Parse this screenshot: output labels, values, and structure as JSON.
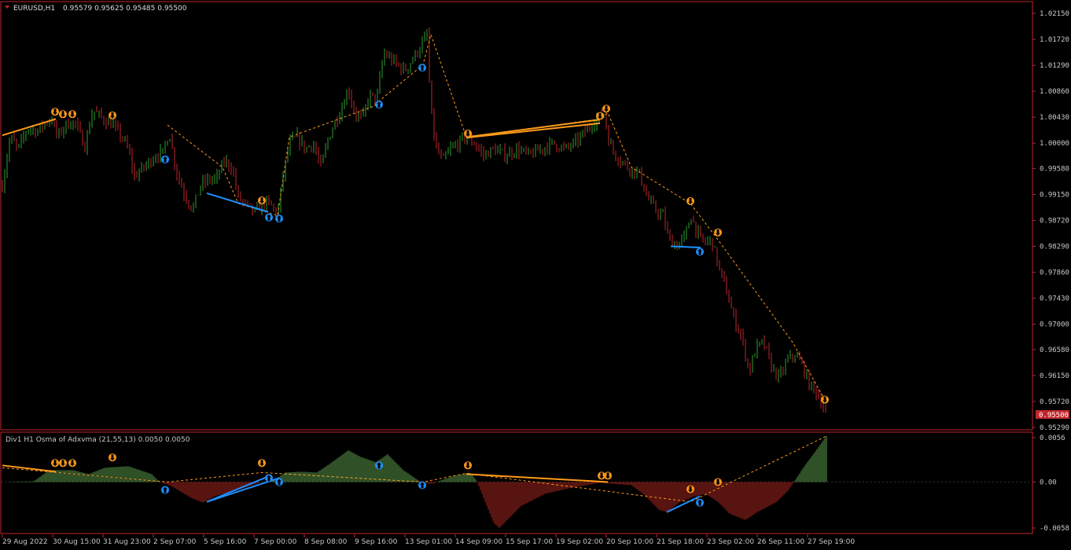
{
  "main_header": {
    "symbol": "EURUSD,H1",
    "ohlc": "0.95579 0.95625 0.95485 0.95500"
  },
  "indicator_header": {
    "label": "Div1 H1 Osma of Adxvma (21,55,13) 0.0050 0.0050"
  },
  "current_price": "0.95500",
  "colors": {
    "background": "#000000",
    "frame": "#c0262c",
    "bull": "#2f9e2f",
    "bear": "#c0262c",
    "hist_pos": "#5f9f4f",
    "hist_neg": "#b0271f",
    "bear_div": "#ff9a1a",
    "bull_div": "#1e90ff",
    "axis_text": "#c8c8c8",
    "header_text": "#dcdcdc"
  },
  "chart_data": [
    {
      "type": "candlestick",
      "title": "EURUSD,H1",
      "ylim": [
        0.9518,
        1.0228
      ],
      "y_ticks": [
        "1.02150",
        "1.01720",
        "1.01290",
        "1.00860",
        "1.00430",
        "1.00000",
        "0.99580",
        "0.99150",
        "0.98720",
        "0.98290",
        "0.97860",
        "0.97430",
        "0.97000",
        "0.96580",
        "0.96150",
        "0.95720",
        "0.95290"
      ],
      "x_ticks": [
        "29 Aug 2022",
        "30 Aug 15:00",
        "31 Aug 23:00",
        "2 Sep 07:00",
        "5 Sep 16:00",
        "7 Sep 00:00",
        "8 Sep 08:00",
        "9 Sep 16:00",
        "13 Sep 01:00",
        "14 Sep 09:00",
        "15 Sep 17:00",
        "19 Sep 02:00",
        "20 Sep 10:00",
        "21 Sep 18:00",
        "23 Sep 02:00",
        "26 Sep 11:00",
        "27 Sep 19:00"
      ],
      "close_path": [
        [
          0,
          0.993
        ],
        [
          10,
          1.001
        ],
        [
          20,
          0.999
        ],
        [
          32,
          1.0025
        ],
        [
          45,
          1.002
        ],
        [
          55,
          1.0035
        ],
        [
          63,
          1.004
        ],
        [
          70,
          1.001
        ],
        [
          80,
          1.003
        ],
        [
          92,
          1.0035
        ],
        [
          105,
          0.9995
        ],
        [
          115,
          1.0055
        ],
        [
          128,
          1.004
        ],
        [
          140,
          1.003
        ],
        [
          152,
          1.001
        ],
        [
          160,
          0.999
        ],
        [
          168,
          0.9945
        ],
        [
          180,
          0.996
        ],
        [
          195,
          0.998
        ],
        [
          205,
          0.9985
        ],
        [
          212,
          1.002
        ],
        [
          220,
          0.996
        ],
        [
          230,
          0.992
        ],
        [
          242,
          0.989
        ],
        [
          252,
          0.993
        ],
        [
          262,
          0.994
        ],
        [
          272,
          0.994
        ],
        [
          282,
          0.997
        ],
        [
          292,
          0.996
        ],
        [
          300,
          0.991
        ],
        [
          312,
          0.9895
        ],
        [
          322,
          0.9885
        ],
        [
          330,
          0.99
        ],
        [
          340,
          0.99
        ],
        [
          350,
          0.988
        ],
        [
          356,
          0.994
        ],
        [
          365,
          1.0
        ],
        [
          375,
          1.001
        ],
        [
          385,
          0.999
        ],
        [
          395,
          1.0
        ],
        [
          405,
          0.996
        ],
        [
          415,
          1.001
        ],
        [
          425,
          1.004
        ],
        [
          432,
          1.006
        ],
        [
          440,
          1.009
        ],
        [
          448,
          1.005
        ],
        [
          458,
          1.004
        ],
        [
          467,
          1.008
        ],
        [
          476,
          1.007
        ],
        [
          485,
          1.015
        ],
        [
          493,
          1.014
        ],
        [
          502,
          1.013
        ],
        [
          512,
          1.012
        ],
        [
          522,
          1.014
        ],
        [
          532,
          1.016
        ],
        [
          540,
          1.018
        ],
        [
          545,
          1.005
        ],
        [
          552,
          0.999
        ],
        [
          560,
          0.997
        ],
        [
          570,
          0.999
        ],
        [
          580,
          1.0
        ],
        [
          590,
          1.001
        ],
        [
          600,
          1.0
        ],
        [
          612,
          0.998
        ],
        [
          625,
          0.999
        ],
        [
          640,
          0.998
        ],
        [
          655,
          0.999
        ],
        [
          670,
          0.998
        ],
        [
          685,
          0.999
        ],
        [
          700,
          1.0
        ],
        [
          715,
          0.999
        ],
        [
          728,
          1.0
        ],
        [
          742,
          1.002
        ],
        [
          755,
          1.004
        ],
        [
          765,
          1.005
        ],
        [
          772,
          1.0
        ],
        [
          780,
          0.998
        ],
        [
          795,
          0.996
        ],
        [
          810,
          0.995
        ],
        [
          820,
          0.991
        ],
        [
          830,
          0.989
        ],
        [
          840,
          0.988
        ],
        [
          848,
          0.984
        ],
        [
          858,
          0.983
        ],
        [
          868,
          0.9845
        ],
        [
          876,
          0.988
        ],
        [
          884,
          0.985
        ],
        [
          892,
          0.9835
        ],
        [
          902,
          0.984
        ],
        [
          912,
          0.979
        ],
        [
          920,
          0.976
        ],
        [
          930,
          0.971
        ],
        [
          940,
          0.968
        ],
        [
          950,
          0.962
        ],
        [
          958,
          0.966
        ],
        [
          968,
          0.967
        ],
        [
          978,
          0.963
        ],
        [
          988,
          0.961
        ],
        [
          998,
          0.964
        ],
        [
          1008,
          0.965
        ],
        [
          1018,
          0.963
        ],
        [
          1026,
          0.96
        ],
        [
          1034,
          0.959
        ],
        [
          1040,
          0.9575
        ],
        [
          1048,
          0.955
        ]
      ],
      "zigzag": [
        [
          210,
          1.003
        ],
        [
          280,
          0.996
        ],
        [
          300,
          0.99
        ],
        [
          350,
          0.988
        ],
        [
          365,
          1.001
        ],
        [
          470,
          1.006
        ],
        [
          535,
          1.013
        ],
        [
          545,
          1.018
        ],
        [
          590,
          1.001
        ],
        [
          760,
          1.004
        ],
        [
          770,
          1.005
        ],
        [
          800,
          0.996
        ],
        [
          875,
          0.99
        ],
        [
          910,
          0.984
        ],
        [
          1005,
          0.967
        ],
        [
          1048,
          0.957
        ]
      ],
      "bear_div_lines": [
        [
          [
            0,
            1.0013
          ],
          [
            68,
            1.004
          ]
        ],
        [
          [
            590,
            1.001
          ],
          [
            760,
            1.0039
          ]
        ],
        [
          [
            590,
            1.0009
          ],
          [
            760,
            1.0033
          ]
        ]
      ],
      "bull_div_lines": [
        [
          [
            260,
            0.9917
          ],
          [
            338,
            0.9886
          ]
        ],
        [
          [
            850,
            0.9829
          ],
          [
            888,
            0.9827
          ]
        ]
      ],
      "bear_arrows": [
        [
          67,
          1.0052
        ],
        [
          77,
          1.0048
        ],
        [
          89,
          1.0048
        ],
        [
          140,
          1.0046
        ],
        [
          330,
          0.9905
        ],
        [
          592,
          1.0016
        ],
        [
          760,
          1.0045
        ],
        [
          768,
          1.0057
        ],
        [
          875,
          0.9904
        ],
        [
          910,
          0.9852
        ],
        [
          1046,
          0.9575
        ]
      ],
      "bull_arrows": [
        [
          207,
          0.9973
        ],
        [
          339,
          0.9877
        ],
        [
          352,
          0.9875
        ],
        [
          479,
          1.0064
        ],
        [
          534,
          1.0125
        ],
        [
          887,
          0.982
        ]
      ]
    },
    {
      "type": "bar",
      "title": "Div1 H1 Osma of Adxvma (21,55,13) 0.0050 0.0050",
      "ylim": [
        -0.0063,
        0.0062
      ],
      "y_ticks": [
        "0.0056",
        "0.00",
        "-0.0058"
      ],
      "histogram_knots": [
        [
          0,
          0
        ],
        [
          40,
          0.0001
        ],
        [
          60,
          0.0015
        ],
        [
          90,
          0.0015
        ],
        [
          110,
          0.001
        ],
        [
          130,
          0.0018
        ],
        [
          160,
          0.002
        ],
        [
          190,
          0.001
        ],
        [
          200,
          0
        ],
        [
          215,
          -0.0005
        ],
        [
          240,
          -0.002
        ],
        [
          255,
          -0.0026
        ],
        [
          270,
          -0.0018
        ],
        [
          300,
          -0.001
        ],
        [
          330,
          0
        ],
        [
          345,
          0.0002
        ],
        [
          360,
          0.0012
        ],
        [
          380,
          0.0013
        ],
        [
          400,
          0.0012
        ],
        [
          415,
          0.0022
        ],
        [
          440,
          0.004
        ],
        [
          455,
          0.0032
        ],
        [
          475,
          0.0025
        ],
        [
          490,
          0.0035
        ],
        [
          510,
          0.0015
        ],
        [
          535,
          -0.0002
        ],
        [
          548,
          -0.0002
        ],
        [
          560,
          0.0003
        ],
        [
          575,
          0.0008
        ],
        [
          595,
          0.0012
        ],
        [
          603,
          0.0002
        ],
        [
          612,
          -0.002
        ],
        [
          625,
          -0.0052
        ],
        [
          632,
          -0.0058
        ],
        [
          640,
          -0.005
        ],
        [
          660,
          -0.003
        ],
        [
          690,
          -0.0015
        ],
        [
          720,
          -0.0008
        ],
        [
          760,
          -0.0001
        ],
        [
          800,
          -0.0004
        ],
        [
          815,
          -0.0015
        ],
        [
          835,
          -0.0035
        ],
        [
          845,
          -0.0038
        ],
        [
          862,
          -0.0025
        ],
        [
          880,
          -0.0018
        ],
        [
          895,
          -0.0015
        ],
        [
          910,
          -0.0025
        ],
        [
          925,
          -0.004
        ],
        [
          945,
          -0.0048
        ],
        [
          960,
          -0.0038
        ],
        [
          985,
          -0.0025
        ],
        [
          1000,
          -0.001
        ],
        [
          1010,
          0.0005
        ],
        [
          1020,
          0.002
        ],
        [
          1035,
          0.004
        ],
        [
          1048,
          0.0058
        ]
      ],
      "zigzag": [
        [
          0,
          0.0018
        ],
        [
          210,
          0
        ],
        [
          330,
          0.0012
        ],
        [
          535,
          0
        ],
        [
          590,
          0.0011
        ],
        [
          875,
          -0.0025
        ],
        [
          1048,
          0.0058
        ]
      ],
      "bear_div_lines": [
        [
          [
            0,
            0.0021
          ],
          [
            68,
            0.0013
          ]
        ],
        [
          [
            590,
            0.001
          ],
          [
            770,
            0
          ]
        ]
      ],
      "bull_div_lines": [
        [
          [
            260,
            -0.0025
          ],
          [
            338,
            0.0007
          ]
        ],
        [
          [
            260,
            -0.0025
          ],
          [
            352,
            0.0005
          ]
        ],
        [
          [
            845,
            -0.0038
          ],
          [
            887,
            -0.0018
          ]
        ]
      ],
      "bear_arrows": [
        [
          67,
          0.0024
        ],
        [
          77,
          0.0024
        ],
        [
          89,
          0.0024
        ],
        [
          140,
          0.0031
        ],
        [
          330,
          0.0024
        ],
        [
          592,
          0.0021
        ],
        [
          762,
          0.0008
        ],
        [
          770,
          0.0008
        ],
        [
          875,
          -0.0009
        ],
        [
          910,
          0
        ]
      ],
      "bull_arrows": [
        [
          207,
          -0.001
        ],
        [
          339,
          0.0005
        ],
        [
          352,
          0
        ],
        [
          479,
          0.0021
        ],
        [
          534,
          -0.0004
        ],
        [
          887,
          -0.0026
        ]
      ]
    }
  ]
}
